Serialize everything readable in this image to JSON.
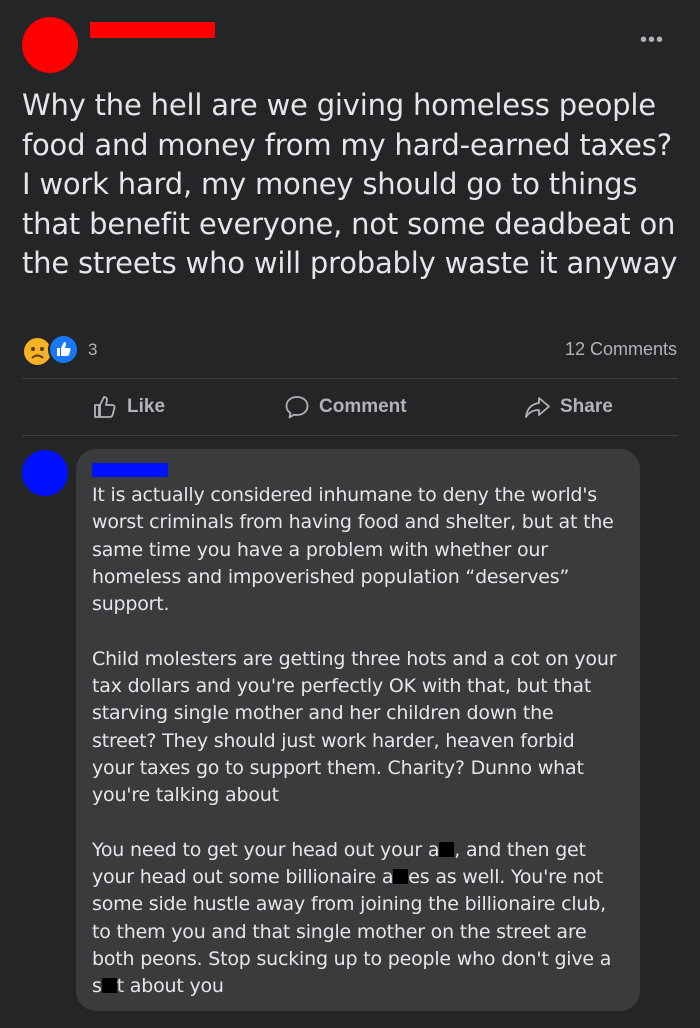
{
  "post": {
    "more_icon": "ellipsis-icon",
    "text": "Why the hell are we giving homeless people food and money from my hard-earned taxes? I work hard, my money should go to things that benefit everyone, not some deadbeat on the streets who will probably waste it anyway",
    "reaction_icons": [
      "sad-reaction-icon",
      "like-reaction-icon"
    ],
    "reaction_count": "3",
    "comments_count": "12 Comments"
  },
  "actions": {
    "like": "Like",
    "comment": "Comment",
    "share": "Share"
  },
  "comment": {
    "p1": "It is actually considered inhumane to deny the world's worst criminals from having food and shelter, but at the same time you have a problem with whether our homeless and impoverished population “deserves” support.",
    "p2": "Child molesters are getting three hots and a cot on your tax dollars and you're perfectly OK with that, but that starving single mother and her children down the street? They should just work harder, heaven forbid your taxes go to support them. Charity? Dunno what you're talking about",
    "p3": {
      "a": "You need to get your head out your a",
      "b": ", and then get your head out some billionaire a",
      "c": "es as well. You're not some side hustle away from joining the billionaire club, to them you and that single mother on the street are both peons. Stop sucking up to people who don't give a s",
      "d": "t about you"
    }
  },
  "colors": {
    "background": "#242526",
    "bubble": "#3a3b3c",
    "text": "#e4e6eb",
    "muted": "#b0b3b8",
    "redact_red": "#ff0000",
    "redact_blue": "#0011ff"
  }
}
